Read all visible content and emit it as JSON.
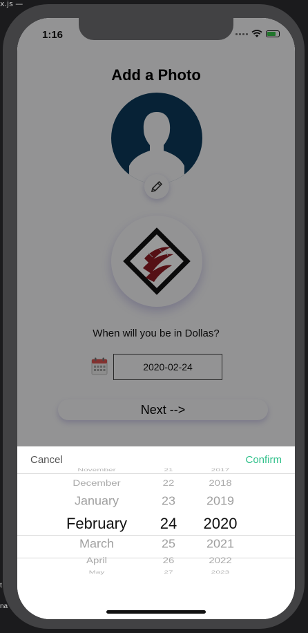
{
  "editor": {
    "tab_text": "x.js — ",
    "side_marks": [
      "t",
      "na"
    ]
  },
  "status_bar": {
    "time": "1:16",
    "battery_level": 0.75,
    "battery_color": "#37c34a"
  },
  "page": {
    "title": "Add a Photo",
    "question": "When will you be in Dollas?",
    "date_value": "2020-02-24",
    "next_label": "Next -->"
  },
  "colors": {
    "avatar_bg": "#0d3a5a",
    "confirm": "#2fc08a",
    "logo_red": "#8e1c24"
  },
  "icons": {
    "avatar": "person-silhouette-icon",
    "edit": "pencil-icon",
    "calendar": "calendar-icon",
    "logo": "diamond-flame-logo"
  },
  "picker": {
    "cancel_label": "Cancel",
    "confirm_label": "Confirm",
    "months": [
      "November",
      "December",
      "January",
      "February",
      "March",
      "April",
      "May"
    ],
    "days": [
      "21",
      "22",
      "23",
      "24",
      "25",
      "26",
      "27"
    ],
    "years": [
      "2017",
      "2018",
      "2019",
      "2020",
      "2021",
      "2022",
      "2023"
    ],
    "selected": {
      "month": "February",
      "day": "24",
      "year": "2020"
    }
  }
}
